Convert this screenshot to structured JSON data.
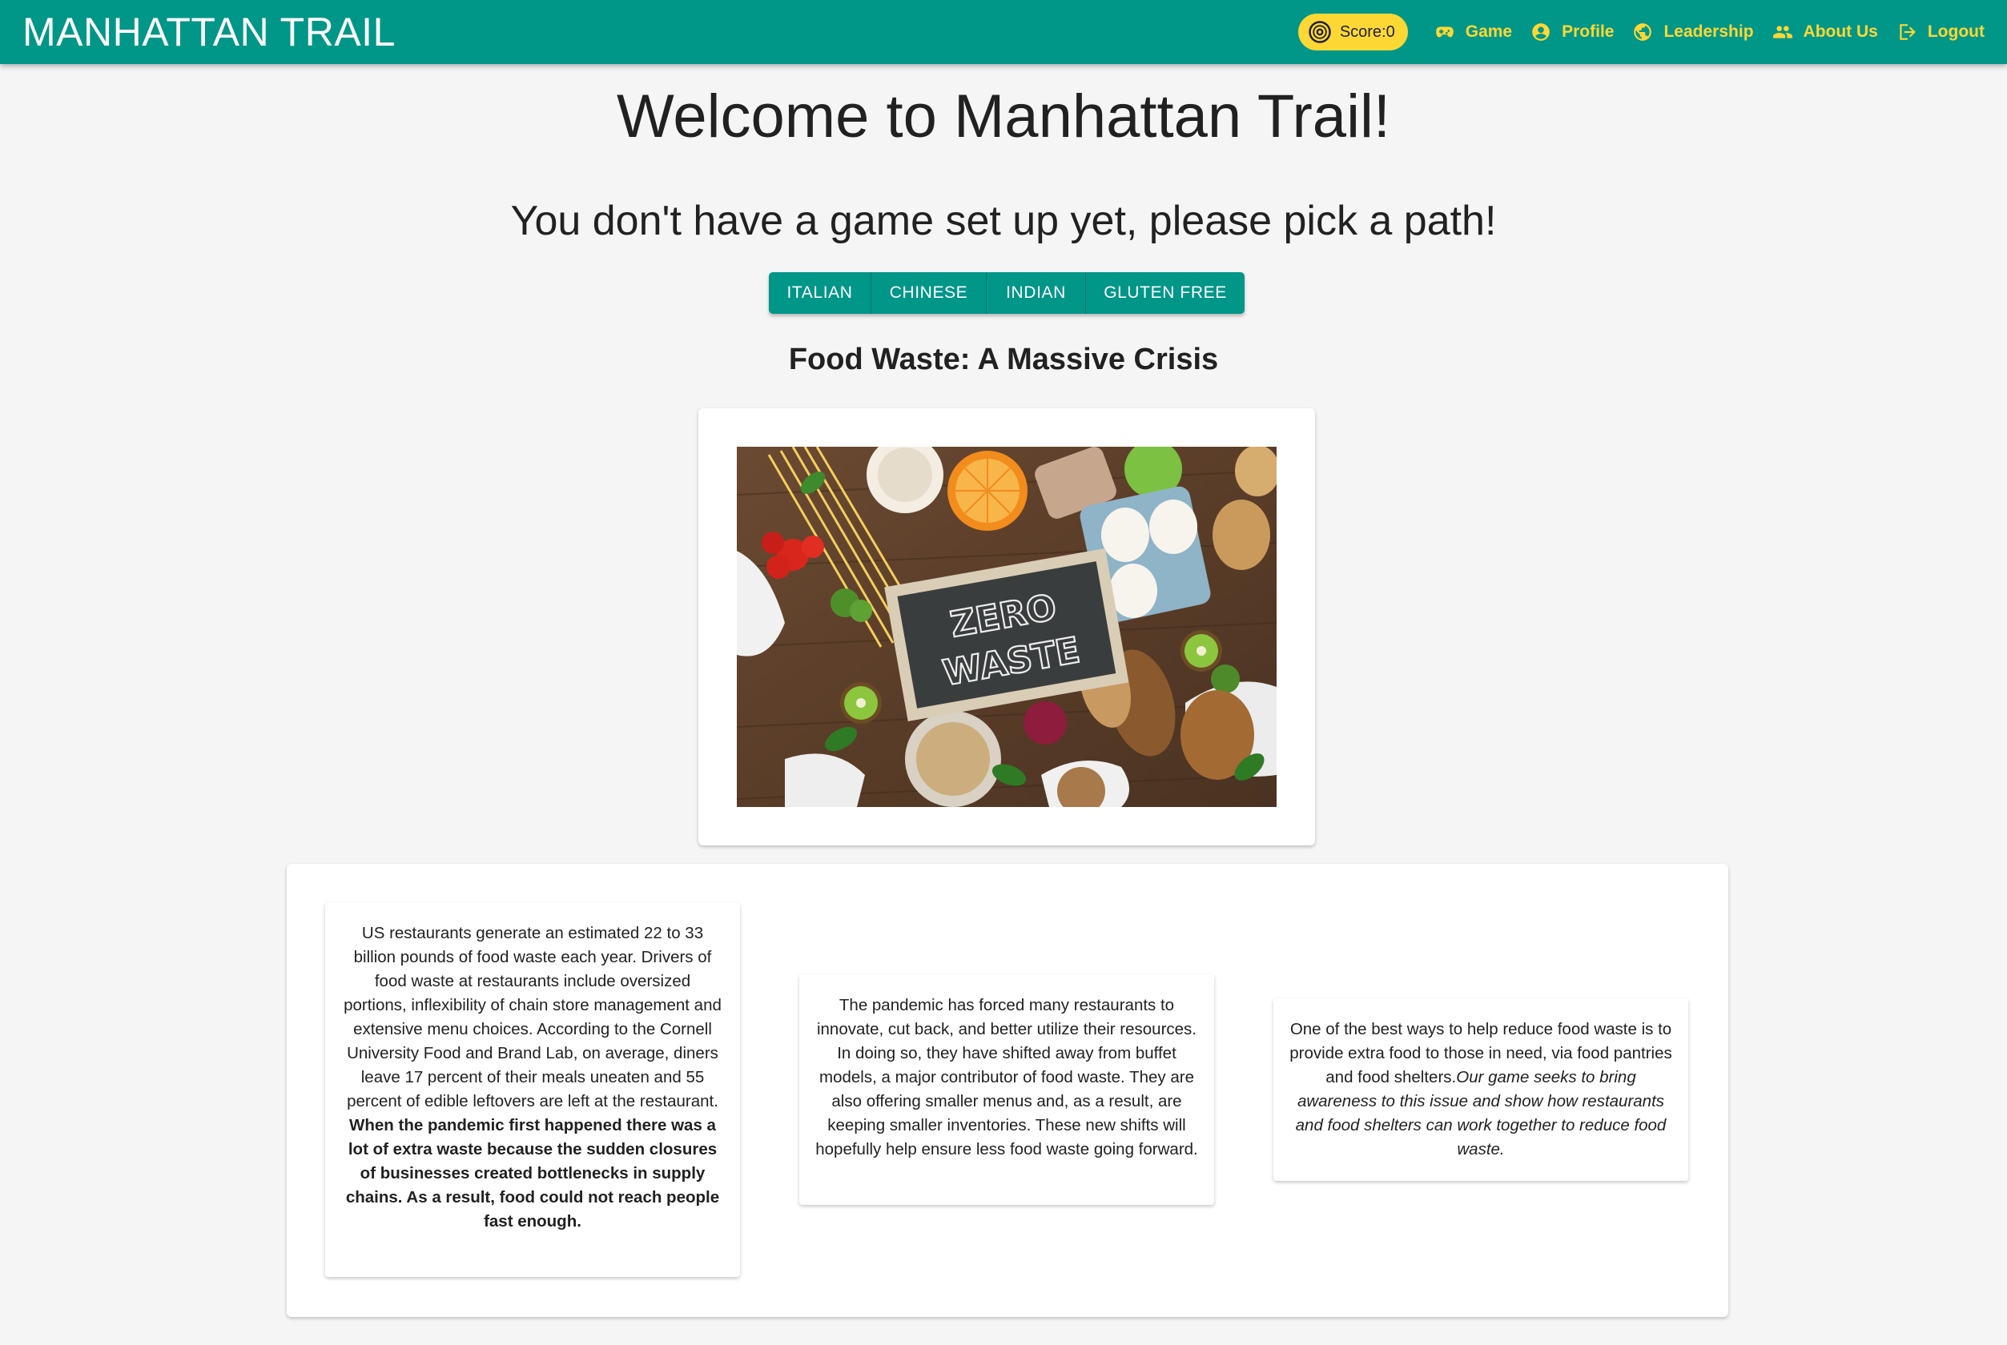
{
  "app": {
    "brand": "MANHATTAN TRAIL",
    "score_label": "Score:0",
    "nav": [
      {
        "label": "Game",
        "icon": "gamepad-icon"
      },
      {
        "label": "Profile",
        "icon": "account-circle-icon"
      },
      {
        "label": "Leadership",
        "icon": "globe-icon"
      },
      {
        "label": "About Us",
        "icon": "people-icon"
      },
      {
        "label": "Logout",
        "icon": "logout-icon"
      }
    ]
  },
  "main": {
    "title": "Welcome to Manhattan Trail!",
    "subtitle": "You don't have a game set up yet, please pick a path!",
    "paths": [
      "ITALIAN",
      "CHINESE",
      "INDIAN",
      "GLUTEN FREE"
    ],
    "heading": "Food Waste: A Massive Crisis",
    "image": {
      "sign_line1": "ZERO",
      "sign_line2": "WASTE"
    },
    "cards": [
      {
        "text": "US restaurants generate an estimated 22 to 33 billion pounds of food waste each year. Drivers of food waste at restaurants include oversized portions, inflexibility of chain store management and extensive menu choices. According to the Cornell University Food and Brand Lab, on average, diners leave 17 percent of their meals uneaten and 55 percent of edible leftovers are left at the restaurant. ",
        "bold": "When the pandemic first happened there was a lot of extra waste because the sudden closures of businesses created bottlenecks in supply chains. As a result, food could not reach people fast enough."
      },
      {
        "text": "The pandemic has forced many restaurants to innovate, cut back, and better utilize their resources. In doing so, they have shifted away from buffet models, a major contributor of food waste. They are also offering smaller menus and, as a result, are keeping smaller inventories. These new shifts will hopefully help ensure less food waste going forward."
      },
      {
        "text": "One of the best ways to help reduce food waste is to provide extra food to those in need, via food pantries and food shelters.",
        "italic": "Our game seeks to bring awareness to this issue and show how restaurants and food shelters can work together to reduce food waste."
      }
    ]
  },
  "colors": {
    "appbar": "#009688",
    "accent": "#fdd835",
    "background": "#f5f5f5"
  }
}
